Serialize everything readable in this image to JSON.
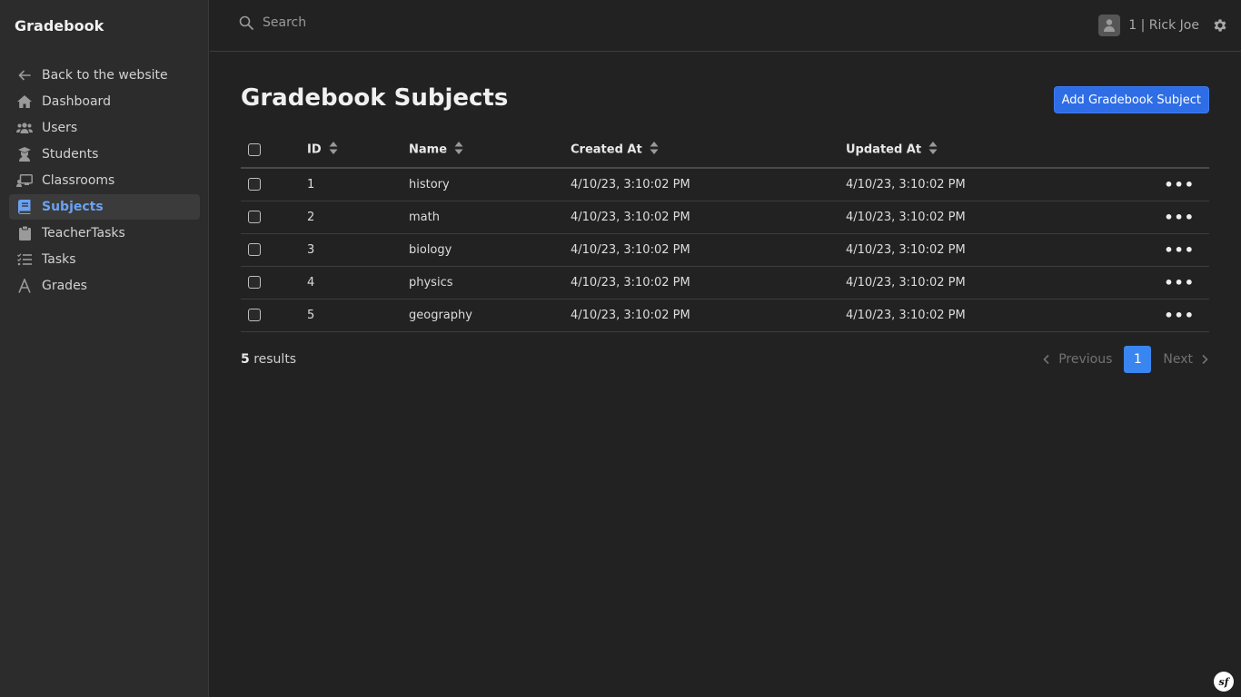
{
  "sidebar": {
    "brand": "Gradebook",
    "items": [
      {
        "label": "Back to the website",
        "icon": "arrow-left-icon"
      },
      {
        "label": "Dashboard",
        "icon": "home-icon"
      },
      {
        "label": "Users",
        "icon": "users-icon"
      },
      {
        "label": "Students",
        "icon": "graduate-icon"
      },
      {
        "label": "Classrooms",
        "icon": "chalkboard-icon"
      },
      {
        "label": "Subjects",
        "icon": "book-icon",
        "active": true
      },
      {
        "label": "TeacherTasks",
        "icon": "clipboard-icon"
      },
      {
        "label": "Tasks",
        "icon": "task-list-icon"
      },
      {
        "label": "Grades",
        "icon": "letter-a-icon"
      }
    ]
  },
  "header": {
    "search_placeholder": "Search",
    "user_label": "1 | Rick Joe"
  },
  "main": {
    "title": "Gradebook Subjects",
    "add_button": "Add Gradebook Subject",
    "columns": [
      "ID",
      "Name",
      "Created At",
      "Updated At"
    ],
    "rows": [
      {
        "id": "1",
        "name": "history",
        "created": "4/10/23, 3:10:02 PM",
        "updated": "4/10/23, 3:10:02 PM"
      },
      {
        "id": "2",
        "name": "math",
        "created": "4/10/23, 3:10:02 PM",
        "updated": "4/10/23, 3:10:02 PM"
      },
      {
        "id": "3",
        "name": "biology",
        "created": "4/10/23, 3:10:02 PM",
        "updated": "4/10/23, 3:10:02 PM"
      },
      {
        "id": "4",
        "name": "physics",
        "created": "4/10/23, 3:10:02 PM",
        "updated": "4/10/23, 3:10:02 PM"
      },
      {
        "id": "5",
        "name": "geography",
        "created": "4/10/23, 3:10:02 PM",
        "updated": "4/10/23, 3:10:02 PM"
      }
    ],
    "results_count": "5",
    "results_label": "results",
    "pagination": {
      "previous": "Previous",
      "current": "1",
      "next": "Next"
    }
  },
  "footer": {
    "logo_text": "sf"
  },
  "colors": {
    "accent": "#2e6de6",
    "active_link": "#6ba2f2",
    "background": "#222222",
    "sidebar": "#2c2c2c"
  }
}
